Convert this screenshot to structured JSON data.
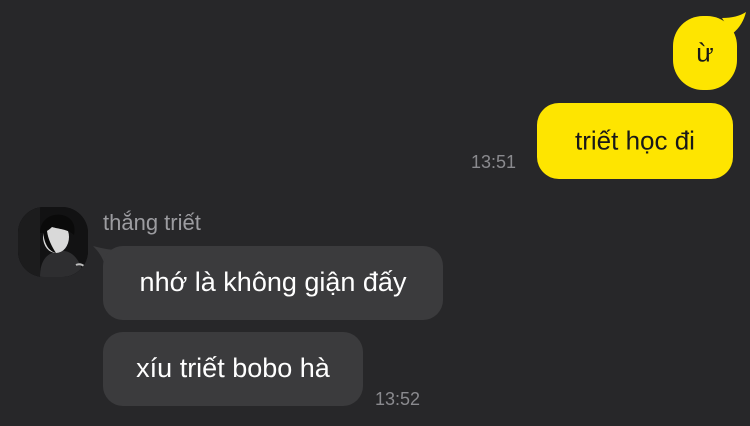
{
  "theme": {
    "background": "#272729",
    "outgoing_bubble": "#fee500",
    "incoming_bubble": "#3b3b3d",
    "timestamp_color": "#8a8a8e"
  },
  "outgoing": [
    {
      "text": "ừ"
    },
    {
      "text": "triết học đi",
      "time": "13:51"
    }
  ],
  "contact": {
    "name": "thắng triết",
    "avatar_icon": "profile-photo"
  },
  "incoming": [
    {
      "text": "nhớ là không giận đấy"
    },
    {
      "text": "xíu triết bobo hà",
      "time": "13:52"
    }
  ]
}
